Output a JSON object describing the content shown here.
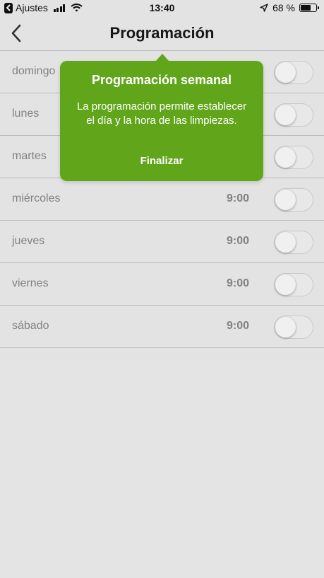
{
  "status_bar": {
    "back_app": "Ajustes",
    "time": "13:40",
    "battery": "68 %",
    "battery_level": 0.68
  },
  "nav": {
    "title": "Programación"
  },
  "schedule": [
    {
      "day": "domingo",
      "time": "",
      "enabled": false
    },
    {
      "day": "lunes",
      "time": "",
      "enabled": false
    },
    {
      "day": "martes",
      "time": "",
      "enabled": false
    },
    {
      "day": "miércoles",
      "time": "9:00",
      "enabled": false
    },
    {
      "day": "jueves",
      "time": "9:00",
      "enabled": false
    },
    {
      "day": "viernes",
      "time": "9:00",
      "enabled": false
    },
    {
      "day": "sábado",
      "time": "9:00",
      "enabled": false
    }
  ],
  "tooltip": {
    "title": "Programación semanal",
    "body": "La programación permite establecer el día y la hora de las limpiezas.",
    "action": "Finalizar"
  },
  "colors": {
    "accent": "#61a61a",
    "background": "#f2f2f2"
  }
}
